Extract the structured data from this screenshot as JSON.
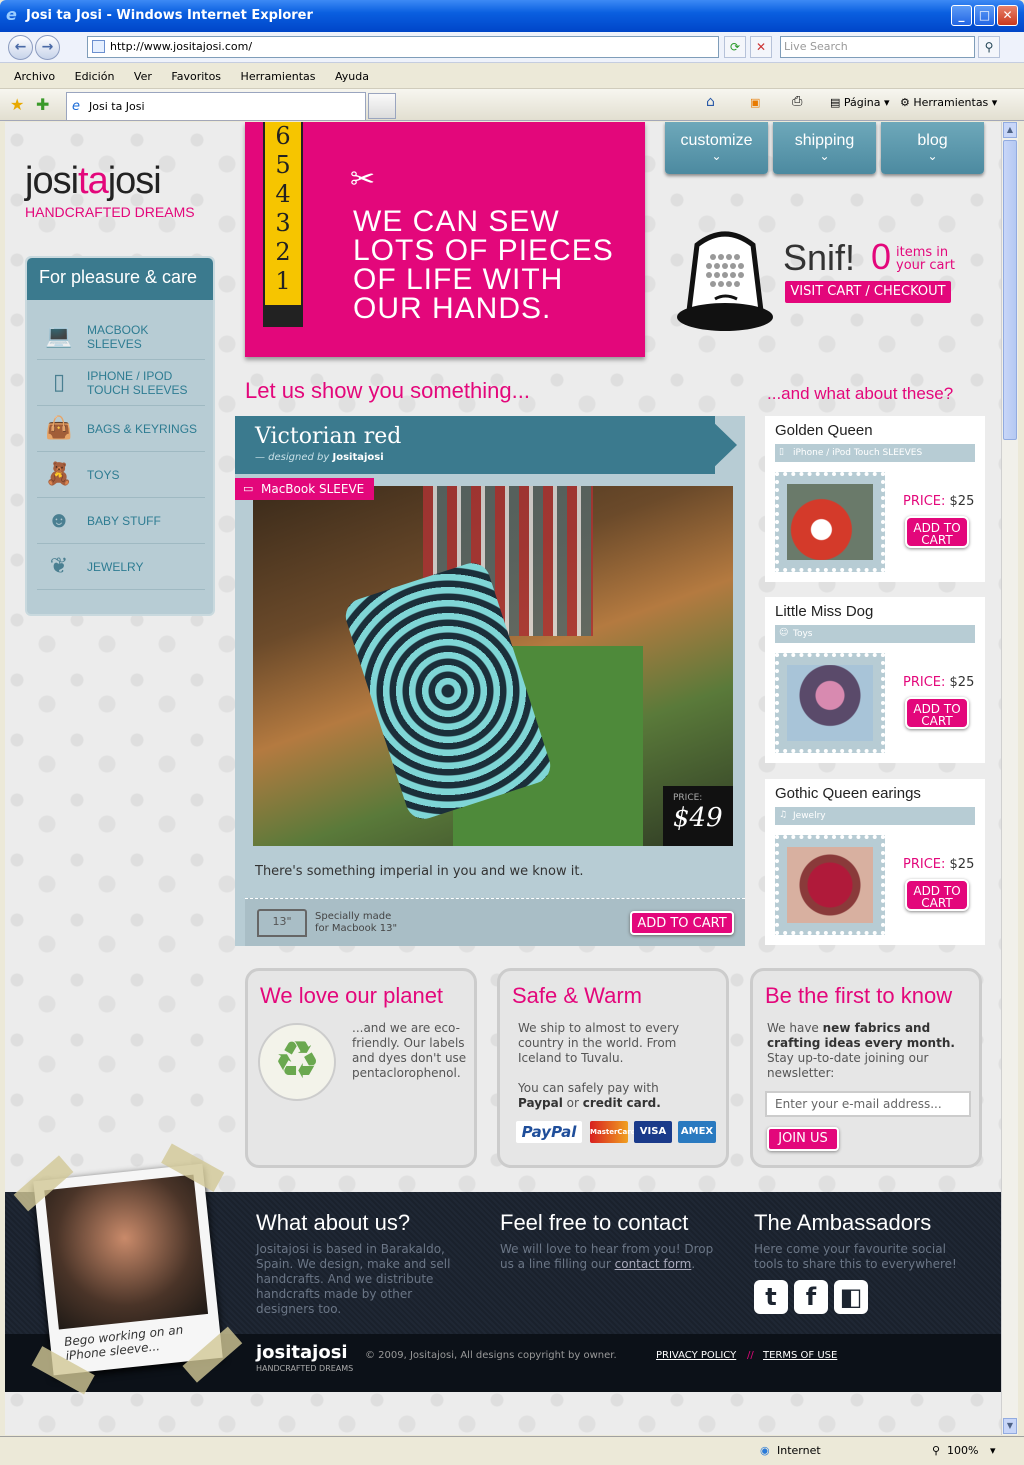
{
  "window": {
    "title": "Josi ta Josi - Windows Internet Explorer",
    "minimize": "_",
    "maximize": "□",
    "close": "✕"
  },
  "browser": {
    "url": "http://www.jositajosi.com/",
    "search_placeholder": "Live Search",
    "tab_title": "Josi ta Josi",
    "menu": [
      "Archivo",
      "Edición",
      "Ver",
      "Favoritos",
      "Herramientas",
      "Ayuda"
    ],
    "cmd_pagina": "Página",
    "cmd_herramientas": "Herramientas",
    "status_zone": "Internet",
    "status_zoom": "100%"
  },
  "site": {
    "logo": {
      "a": "josi",
      "b": "ta",
      "c": "josi",
      "tagline": "HANDCRAFTED DREAMS"
    },
    "sidebar": {
      "title": "For pleasure & care",
      "items": [
        {
          "label": "MACBOOK SLEEVES",
          "icon": "laptop-icon"
        },
        {
          "label": "IPHONE / IPOD TOUCH SLEEVES",
          "icon": "phone-icon"
        },
        {
          "label": "BAGS & KEYRINGS",
          "icon": "bag-icon"
        },
        {
          "label": "TOYS",
          "icon": "teddy-bear-icon"
        },
        {
          "label": "BABY STUFF",
          "icon": "bib-icon"
        },
        {
          "label": "JEWELRY",
          "icon": "earrings-icon"
        }
      ]
    },
    "hero": {
      "ruler": [
        "6",
        "5",
        "4",
        "3",
        "2",
        "1"
      ],
      "text": "WE CAN SEW LOTS OF PIECES OF LIFE WITH OUR HANDS."
    },
    "nav": [
      "customize",
      "shipping",
      "blog"
    ],
    "cart": {
      "snif": "Snif!",
      "count": "0",
      "label": "items in your cart",
      "button": "VISIT CART / CHECKOUT"
    },
    "featured_heading": "Let us show you something...",
    "more_heading": "...and what about these?",
    "featured": {
      "title": "Victorian red",
      "designed_by": "— designed by",
      "designer": "Jositajosi",
      "tag": "MacBook SLEEVE",
      "price_label": "PRICE:",
      "price": "$49",
      "description": "There's something imperial in you and we know it.",
      "laptop_size": "13\"",
      "spec_line1": "Specially made",
      "spec_line2": "for Macbook 13\"",
      "add": "ADD TO CART"
    },
    "products": [
      {
        "title": "Golden Queen",
        "category": "iPhone / iPod Touch SLEEVES",
        "price_label": "PRICE:",
        "price": "$25",
        "add": "ADD TO CART"
      },
      {
        "title": "Little Miss Dog",
        "category": "Toys",
        "price_label": "PRICE:",
        "price": "$25",
        "add": "ADD TO CART"
      },
      {
        "title": "Gothic Queen earings",
        "category": "Jewelry",
        "price_label": "PRICE:",
        "price": "$25",
        "add": "ADD TO CART"
      }
    ],
    "planet": {
      "title": "We love our planet",
      "text": "...and we are eco-friendly. Our labels and dyes don't use pentaclorophenol."
    },
    "safe": {
      "title": "Safe & Warm",
      "text1": "We ship to almost to every country in the world. From Iceland to Tuvalu.",
      "text2a": "You can safely pay with",
      "paypal": "Paypal",
      "or": "or",
      "credit": "credit card.",
      "cards": [
        "PayPal",
        "MasterCard",
        "VISA",
        "AMEX"
      ]
    },
    "news": {
      "title": "Be the first to know",
      "text_a": "We have",
      "text_b": "new fabrics and crafting ideas every month.",
      "text_c": "Stay up-to-date joining our newsletter:",
      "placeholder": "Enter your e-mail address...",
      "join": "JOIN US"
    },
    "footer": {
      "about_title": "What about us?",
      "about_text": "Jositajosi is based in Barakaldo, Spain. We design, make and sell handcrafts. And we distribute handcrafts made by other designers too.",
      "contact_title": "Feel free to contact",
      "contact_text": "We will love to hear from you! Drop us a line filling our",
      "contact_link": "contact form",
      "amb_title": "The Ambassadors",
      "amb_text": "Here come your favourite social tools to share this to everywhere!",
      "social": [
        "t",
        "f",
        "◧"
      ],
      "polaroid_caption": "Bego working on an iPhone sleeve...",
      "logo": "jositajosi",
      "logo_sub": "HANDCRAFTED DREAMS",
      "copyright": "© 2009, Jositajosi, All designs copyright by owner.",
      "privacy": "PRIVACY POLICY",
      "sep": "//",
      "terms": "TERMS OF USE"
    }
  }
}
